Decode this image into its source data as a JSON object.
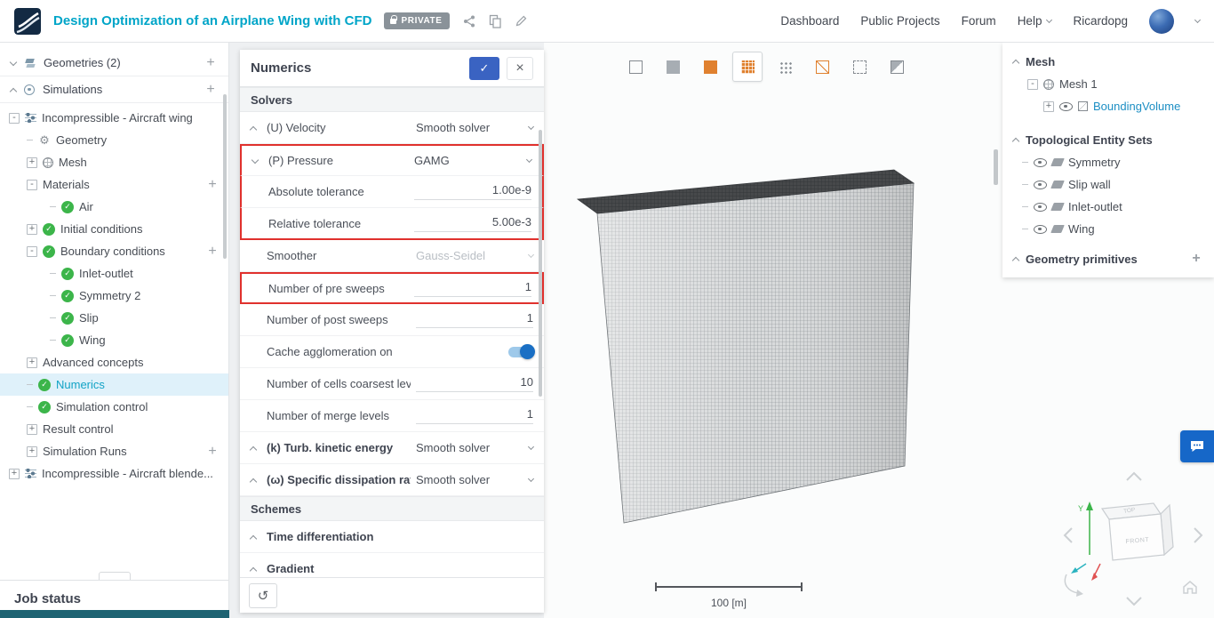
{
  "colors": {
    "accent_teal": "#00a5c8",
    "check_green": "#3cb54a",
    "highlight_red": "#e0312d",
    "apply_blue": "#3a63c2",
    "toggle_blue": "#1a6fc4",
    "chat_blue": "#1667c8",
    "mesh_orange": "#e0812f",
    "selected_row_bg": "#dff1fa"
  },
  "header": {
    "title": "Design Optimization of an Airplane Wing with CFD",
    "private_badge": "PRIVATE",
    "nav": [
      {
        "label": "Dashboard"
      },
      {
        "label": "Public Projects"
      },
      {
        "label": "Forum"
      }
    ],
    "help_label": "Help",
    "username": "Ricardopg"
  },
  "sidebar": {
    "geometries_label": "Geometries (2)",
    "simulations_label": "Simulations",
    "job_status_label": "Job status",
    "tree": [
      {
        "label": "Incompressible - Aircraft wing",
        "level": 0,
        "exp": "-",
        "icon_sim": true
      },
      {
        "label": "Geometry",
        "level": 1,
        "dash": true,
        "icon_gear": true
      },
      {
        "label": "Mesh",
        "level": 1,
        "exp": "+",
        "icon_mesh": true
      },
      {
        "label": "Materials",
        "level": 1,
        "exp": "-",
        "plus": true
      },
      {
        "label": "Air",
        "level": 2,
        "dash": true,
        "check": true
      },
      {
        "label": "Initial conditions",
        "level": 1,
        "exp": "+",
        "check": true
      },
      {
        "label": "Boundary conditions",
        "level": 1,
        "exp": "-",
        "check": true,
        "plus": true
      },
      {
        "label": "Inlet-outlet",
        "level": 2,
        "dash": true,
        "check": true
      },
      {
        "label": "Symmetry 2",
        "level": 2,
        "dash": true,
        "check": true
      },
      {
        "label": "Slip",
        "level": 2,
        "dash": true,
        "check": true
      },
      {
        "label": "Wing",
        "level": 2,
        "dash": true,
        "check": true
      },
      {
        "label": "Advanced concepts",
        "level": 1,
        "exp": "+"
      },
      {
        "label": "Numerics",
        "level": 1,
        "dash": true,
        "check": true,
        "selected": true
      },
      {
        "label": "Simulation control",
        "level": 1,
        "dash": true,
        "check": true
      },
      {
        "label": "Result control",
        "level": 1,
        "exp": "+"
      },
      {
        "label": "Simulation Runs",
        "level": 1,
        "exp": "+",
        "plus": true
      },
      {
        "label": "Incompressible - Aircraft blende...",
        "level": 0,
        "exp": "+",
        "icon_sim": true
      }
    ]
  },
  "numerics": {
    "title": "Numerics",
    "rows": [
      {
        "label": "Solvers",
        "section": true
      },
      {
        "label": "(U) Velocity",
        "caret_up": true,
        "is_select": true,
        "value": "Smooth solver"
      },
      {
        "label": "(P) Pressure",
        "caret_down": true,
        "is_select": true,
        "value": "GAMG",
        "red_top": true
      },
      {
        "label": "Absolute tolerance",
        "is_input": true,
        "value": "1.00e-9",
        "red_mid": true
      },
      {
        "label": "Relative tolerance",
        "is_input": true,
        "value": "5.00e-3",
        "red_bot": true
      },
      {
        "label": "Smoother",
        "is_select": true,
        "value": "Gauss-Seidel",
        "disabled": true
      },
      {
        "label": "Number of pre sweeps",
        "is_input": true,
        "value": "1",
        "red_full": true
      },
      {
        "label": "Number of post sweeps",
        "is_input": true,
        "value": "1"
      },
      {
        "label": "Cache agglomeration on",
        "is_toggle": true,
        "on": true
      },
      {
        "label": "Number of cells coarsest level",
        "is_input": true,
        "value": "10"
      },
      {
        "label": "Number of merge levels",
        "is_input": true,
        "value": "1"
      },
      {
        "label": "(k) Turb. kinetic energy",
        "caret_up": true,
        "is_select": true,
        "value": "Smooth solver",
        "bold": true
      },
      {
        "label": "(ω) Specific dissipation rate",
        "caret_up": true,
        "is_select": true,
        "value": "Smooth solver",
        "bold": true
      },
      {
        "label": "Schemes",
        "section": true
      },
      {
        "label": "Time differentiation",
        "caret_up": true,
        "bold": true
      },
      {
        "label": "Gradient",
        "caret_up": true,
        "bold": true
      }
    ]
  },
  "viewport": {
    "toolbar": [
      {
        "name": "fit-view-icon",
        "cls": "vicon k-outline"
      },
      {
        "name": "surface-view-icon",
        "cls": "vicon k-solid"
      },
      {
        "name": "solid-mesh-view-icon",
        "cls": "vicon k-orange"
      },
      {
        "name": "surface-mesh-view-icon",
        "cls": "vicon k-meshorange",
        "selected": true
      },
      {
        "name": "node-view-icon",
        "cls": "vicon k-dots"
      },
      {
        "name": "wireframe-view-icon",
        "cls": "vicon k-wireorange"
      },
      {
        "name": "box-select-icon",
        "cls": "vicon k-dashed"
      },
      {
        "name": "mesh-clip-icon",
        "cls": "vicon k-clip"
      }
    ],
    "scale_label": "100 [m]",
    "cube": {
      "front_label": "FRONT",
      "top_label": "TOP",
      "y_axis_label": "Y"
    }
  },
  "right_panel": {
    "mesh_header": "Mesh",
    "mesh_rows": [
      {
        "label": "Mesh 1",
        "level": 1,
        "exp": "-",
        "icon_mesh": true
      },
      {
        "label": "BoundingVolume",
        "level": 2,
        "exp": "+",
        "eye": true,
        "icon_box": true,
        "blue": true
      }
    ],
    "topo_header": "Topological Entity Sets",
    "topo_rows": [
      {
        "label": "Symmetry",
        "dash": true,
        "eye": true,
        "icon_face": true
      },
      {
        "label": "Slip wall",
        "dash": true,
        "eye": true,
        "icon_face": true
      },
      {
        "label": "Inlet-outlet",
        "dash": true,
        "eye": true,
        "icon_face": true
      },
      {
        "label": "Wing",
        "dash": true,
        "eye": true,
        "icon_face": true
      }
    ],
    "geometry_primitives_header": "Geometry primitives"
  }
}
